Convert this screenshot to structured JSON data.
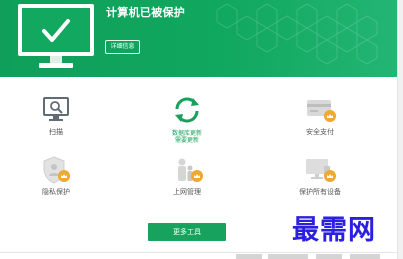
{
  "header": {
    "status_title": "计算机已被保护",
    "details_button": "详细信息",
    "colors": {
      "primary": "#10a75e",
      "accent_green": "#19a15b"
    }
  },
  "features": [
    {
      "id": "scan",
      "label": "扫描",
      "icon": "scan-monitor-icon"
    },
    {
      "id": "update",
      "label_line1": "数据库更新",
      "label_line2": "需要更新",
      "icon": "refresh-icon"
    },
    {
      "id": "safe_pay",
      "label": "安全支付",
      "icon": "credit-card-icon",
      "locked": true
    },
    {
      "id": "privacy",
      "label": "隐私保护",
      "icon": "shield-user-icon",
      "locked": true
    },
    {
      "id": "parental",
      "label": "上网管理",
      "icon": "family-icon",
      "locked": true
    },
    {
      "id": "all_devices",
      "label": "保护所有设备",
      "icon": "devices-icon",
      "locked": true
    }
  ],
  "more_tools_button": "更多工具",
  "watermark": "最需网"
}
